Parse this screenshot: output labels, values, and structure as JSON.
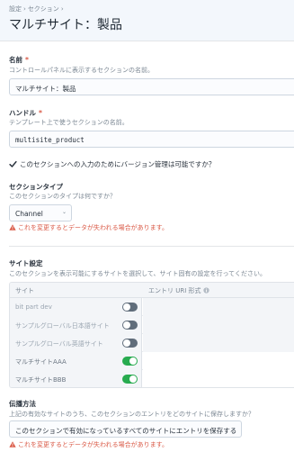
{
  "breadcrumb": [
    "設定",
    "セクション"
  ],
  "page_title": "マルチサイト：製品",
  "name_field": {
    "label": "名前",
    "required_mark": "*",
    "instructions": "コントロールパネルに表示するセクションの名前。",
    "value": "マルチサイト：製品"
  },
  "handle_field": {
    "label": "ハンドル",
    "required_mark": "*",
    "instructions": "テンプレート上で使うセクションの名前。",
    "value": "multisite_product"
  },
  "versioning": {
    "label": "このセクションへの入力のためにバージョン管理は可能ですか？",
    "checked": true
  },
  "section_type": {
    "label": "セクションタイプ",
    "instructions": "このセクションのタイプは何ですか？",
    "selected": "Channel",
    "warning": "これを変更するとデータが失われる場合があります。"
  },
  "site_settings": {
    "label": "サイト設定",
    "instructions": "このセクションを表示可能にするサイトを選択して、サイト固有の設定を行ってください。",
    "columns": [
      "サイト",
      "エントリ URI 形式"
    ],
    "rows": [
      {
        "site": "bit part dev",
        "enabled": false
      },
      {
        "site": "サンプルグローバル日本語サイト",
        "enabled": false
      },
      {
        "site": "サンプルグローバル英語サイト",
        "enabled": false
      },
      {
        "site": "マルチサイトAAA",
        "enabled": true
      },
      {
        "site": "マルチサイトBBB",
        "enabled": true
      }
    ]
  },
  "propagation": {
    "label": "伝播方法",
    "instructions": "上記の有効なサイトのうち、このセクションのエントリをどのサイトに保存しますか？",
    "selected": "このセクションで有効になっているすべてのサイトにエントリを保存する",
    "warning": "これを変更するとデータが失われる場合があります。"
  },
  "colors": {
    "accent_warning": "#da5a47",
    "toggle_on": "#27ab4f",
    "toggle_off": "#606d7b",
    "header_bg": "#f3f7fc"
  },
  "icons": {
    "breadcrumb_separator": "chevron-right-icon",
    "select_arrow": "chevron-down-icon",
    "warning": "warning-triangle-icon",
    "info": "info-icon",
    "checkbox": "checkmark-icon"
  }
}
